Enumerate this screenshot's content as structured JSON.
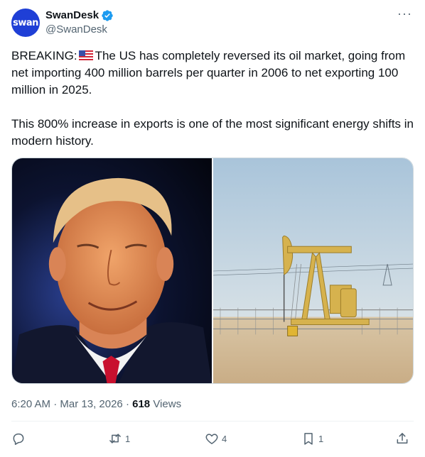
{
  "author": {
    "avatar_text": "swan",
    "name": "SwanDesk",
    "handle": "@SwanDesk",
    "verified": true
  },
  "more_icon": "more-icon",
  "tweet": {
    "prefix": "BREAKING:",
    "flag": "us-flag",
    "paragraph1_rest": "The US has completely reversed its oil market, going from net importing 400 million barrels per quarter in 2006 to net exporting 100 million in 2025.",
    "paragraph2": "This 800% increase in exports is one of the most significant energy shifts in modern history."
  },
  "media": {
    "images": [
      "smiling-man-photo",
      "oil-pumpjack-photo"
    ]
  },
  "meta": {
    "time": "6:20 AM",
    "separator": "·",
    "date": "Mar 13, 2026",
    "views_count": "618",
    "views_label": "Views"
  },
  "actions": {
    "reply": {
      "icon": "reply-icon",
      "count": ""
    },
    "retweet": {
      "icon": "retweet-icon",
      "count": "1"
    },
    "like": {
      "icon": "heart-icon",
      "count": "4"
    },
    "bookmark": {
      "icon": "bookmark-icon",
      "count": "1"
    },
    "share": {
      "icon": "share-icon",
      "count": ""
    }
  },
  "colors": {
    "text": "#0f1419",
    "secondary": "#536471",
    "verified": "#1d9bf0",
    "avatar": "#1f3fd6",
    "border": "#cfd9de"
  }
}
